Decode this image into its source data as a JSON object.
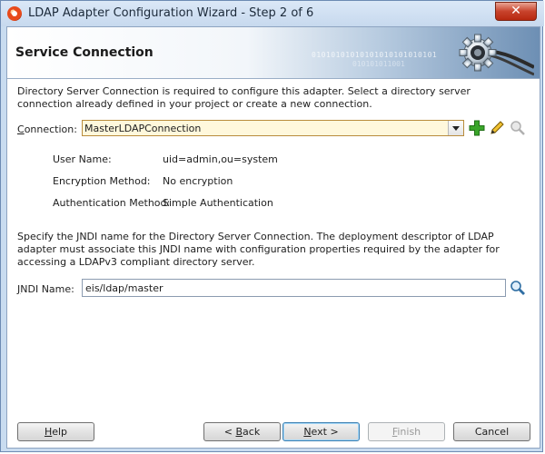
{
  "window": {
    "title": "LDAP Adapter Configuration Wizard - Step 2 of 6",
    "close_label": "✕"
  },
  "header": {
    "title": "Service Connection",
    "binary_deco": "01010101010101010101010101",
    "binary_deco2": "010101011001"
  },
  "connection_section": {
    "description": "Directory Server Connection is required to configure this adapter. Select a directory server connection already defined in your project or create a new connection.",
    "label": "Connection:",
    "selected": "MasterLDAPConnection",
    "details": [
      {
        "label": "User Name:",
        "value": "uid=admin,ou=system"
      },
      {
        "label": "Encryption Method:",
        "value": "No encryption"
      },
      {
        "label": "Authentication Method:",
        "value": "Simple Authentication"
      }
    ]
  },
  "jndi_section": {
    "description": "Specify the JNDI name for the Directory Server Connection. The deployment descriptor of LDAP adapter must associate this JNDI name with configuration properties required by the adapter for accessing a LDAPv3 compliant directory server.",
    "label_mnemonic": "J",
    "label_rest": "NDI Name:",
    "value": "eis/ldap/master"
  },
  "buttons": {
    "help": {
      "mn": "H",
      "rest": "elp"
    },
    "back": {
      "pre": "< ",
      "mn": "B",
      "rest": "ack"
    },
    "next": {
      "mn": "N",
      "rest": "ext >"
    },
    "finish": {
      "mn": "F",
      "rest": "inish"
    },
    "cancel": "Cancel"
  },
  "colors": {
    "accent": "#c9dcf0",
    "add_icon": "#3aa52a",
    "select_border": "#b98c3c"
  }
}
